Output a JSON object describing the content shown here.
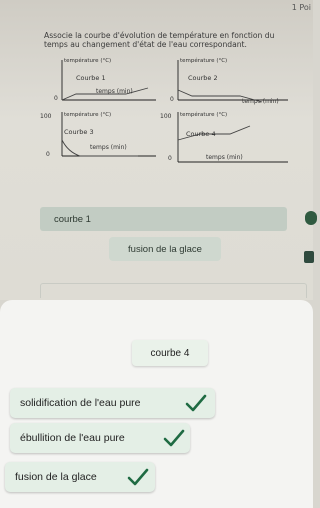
{
  "header": {
    "points": "1 Poi"
  },
  "question": {
    "line1": "Associe la courbe d'évolution de température en fonction du",
    "line2": "temps au changement d'état de l'eau correspondant."
  },
  "graphs": [
    {
      "title": "Courbe 1",
      "ylabel": "température (°C)",
      "xlabel": "temps (min)",
      "tick_top": "",
      "tick_zero": "0"
    },
    {
      "title": "Courbe 2",
      "ylabel": "température (°C)",
      "xlabel": "temps (min)",
      "tick_top": "",
      "tick_zero": "0"
    },
    {
      "title": "Courbe 3",
      "ylabel": "température (°C)",
      "xlabel": "temps (min)",
      "tick_top": "100",
      "tick_zero": "0"
    },
    {
      "title": "Courbe 4",
      "ylabel": "température (°C)",
      "xlabel": "temps (min)",
      "tick_top": "100",
      "tick_zero": "0"
    }
  ],
  "matching": {
    "placed": [
      {
        "curve": "courbe 1",
        "answer": "fusion de la glace"
      }
    ],
    "active_curve": "courbe 4",
    "options": [
      {
        "label": "solidification de l'eau pure",
        "checked": true
      },
      {
        "label": "ébullition de l'eau pure",
        "checked": true
      },
      {
        "label": "fusion de la glace",
        "checked": true
      }
    ]
  },
  "colors": {
    "check": "#1f6b43",
    "option_bg": "#e4efe6",
    "panel_bg": "#f4f4f2"
  },
  "icons": {
    "check": "check-icon"
  }
}
